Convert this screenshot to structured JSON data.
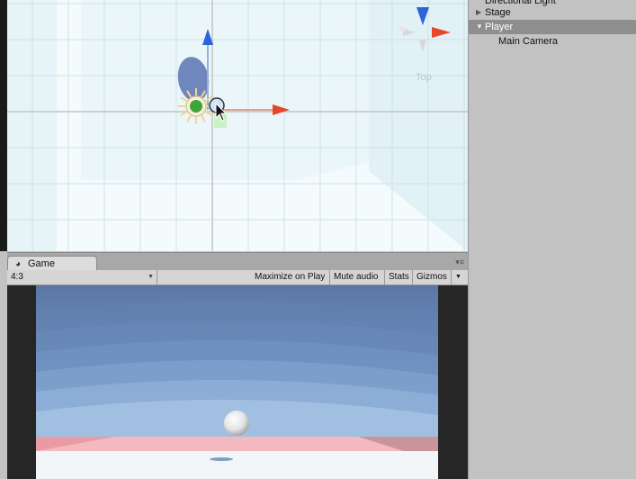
{
  "scene": {
    "orientation_label": "Top"
  },
  "hierarchy": {
    "items": [
      {
        "label": "Directional Light",
        "expandable": false,
        "selected": false,
        "indent": 0
      },
      {
        "label": "Stage",
        "expandable": true,
        "expanded": false,
        "selected": false,
        "indent": 0
      },
      {
        "label": "Player",
        "expandable": true,
        "expanded": true,
        "selected": true,
        "indent": 0
      },
      {
        "label": "Main Camera",
        "expandable": false,
        "selected": false,
        "indent": 1
      }
    ]
  },
  "game": {
    "tab_label": "Game",
    "aspect": "4:3",
    "toolbar": {
      "maximize": "Maximize on Play",
      "mute": "Mute audio",
      "stats": "Stats",
      "gizmos": "Gizmos"
    }
  },
  "colors": {
    "hierarchy_bg": "#c2c2c2",
    "selection": "#8e8e8e",
    "scene_bg": "#f4fbfd",
    "grid": "#cfe1e6",
    "axis_x": "#e8452a",
    "axis_y": "#2b63d9",
    "pivot_green": "#3fa53a",
    "sky_top": "#5b7ea8",
    "floor_pink": "#f4b8bf"
  },
  "icons": {
    "game_tab": "pacman-icon",
    "scene_gizmo": "axis-gizmo-icon",
    "light": "sun-icon"
  }
}
